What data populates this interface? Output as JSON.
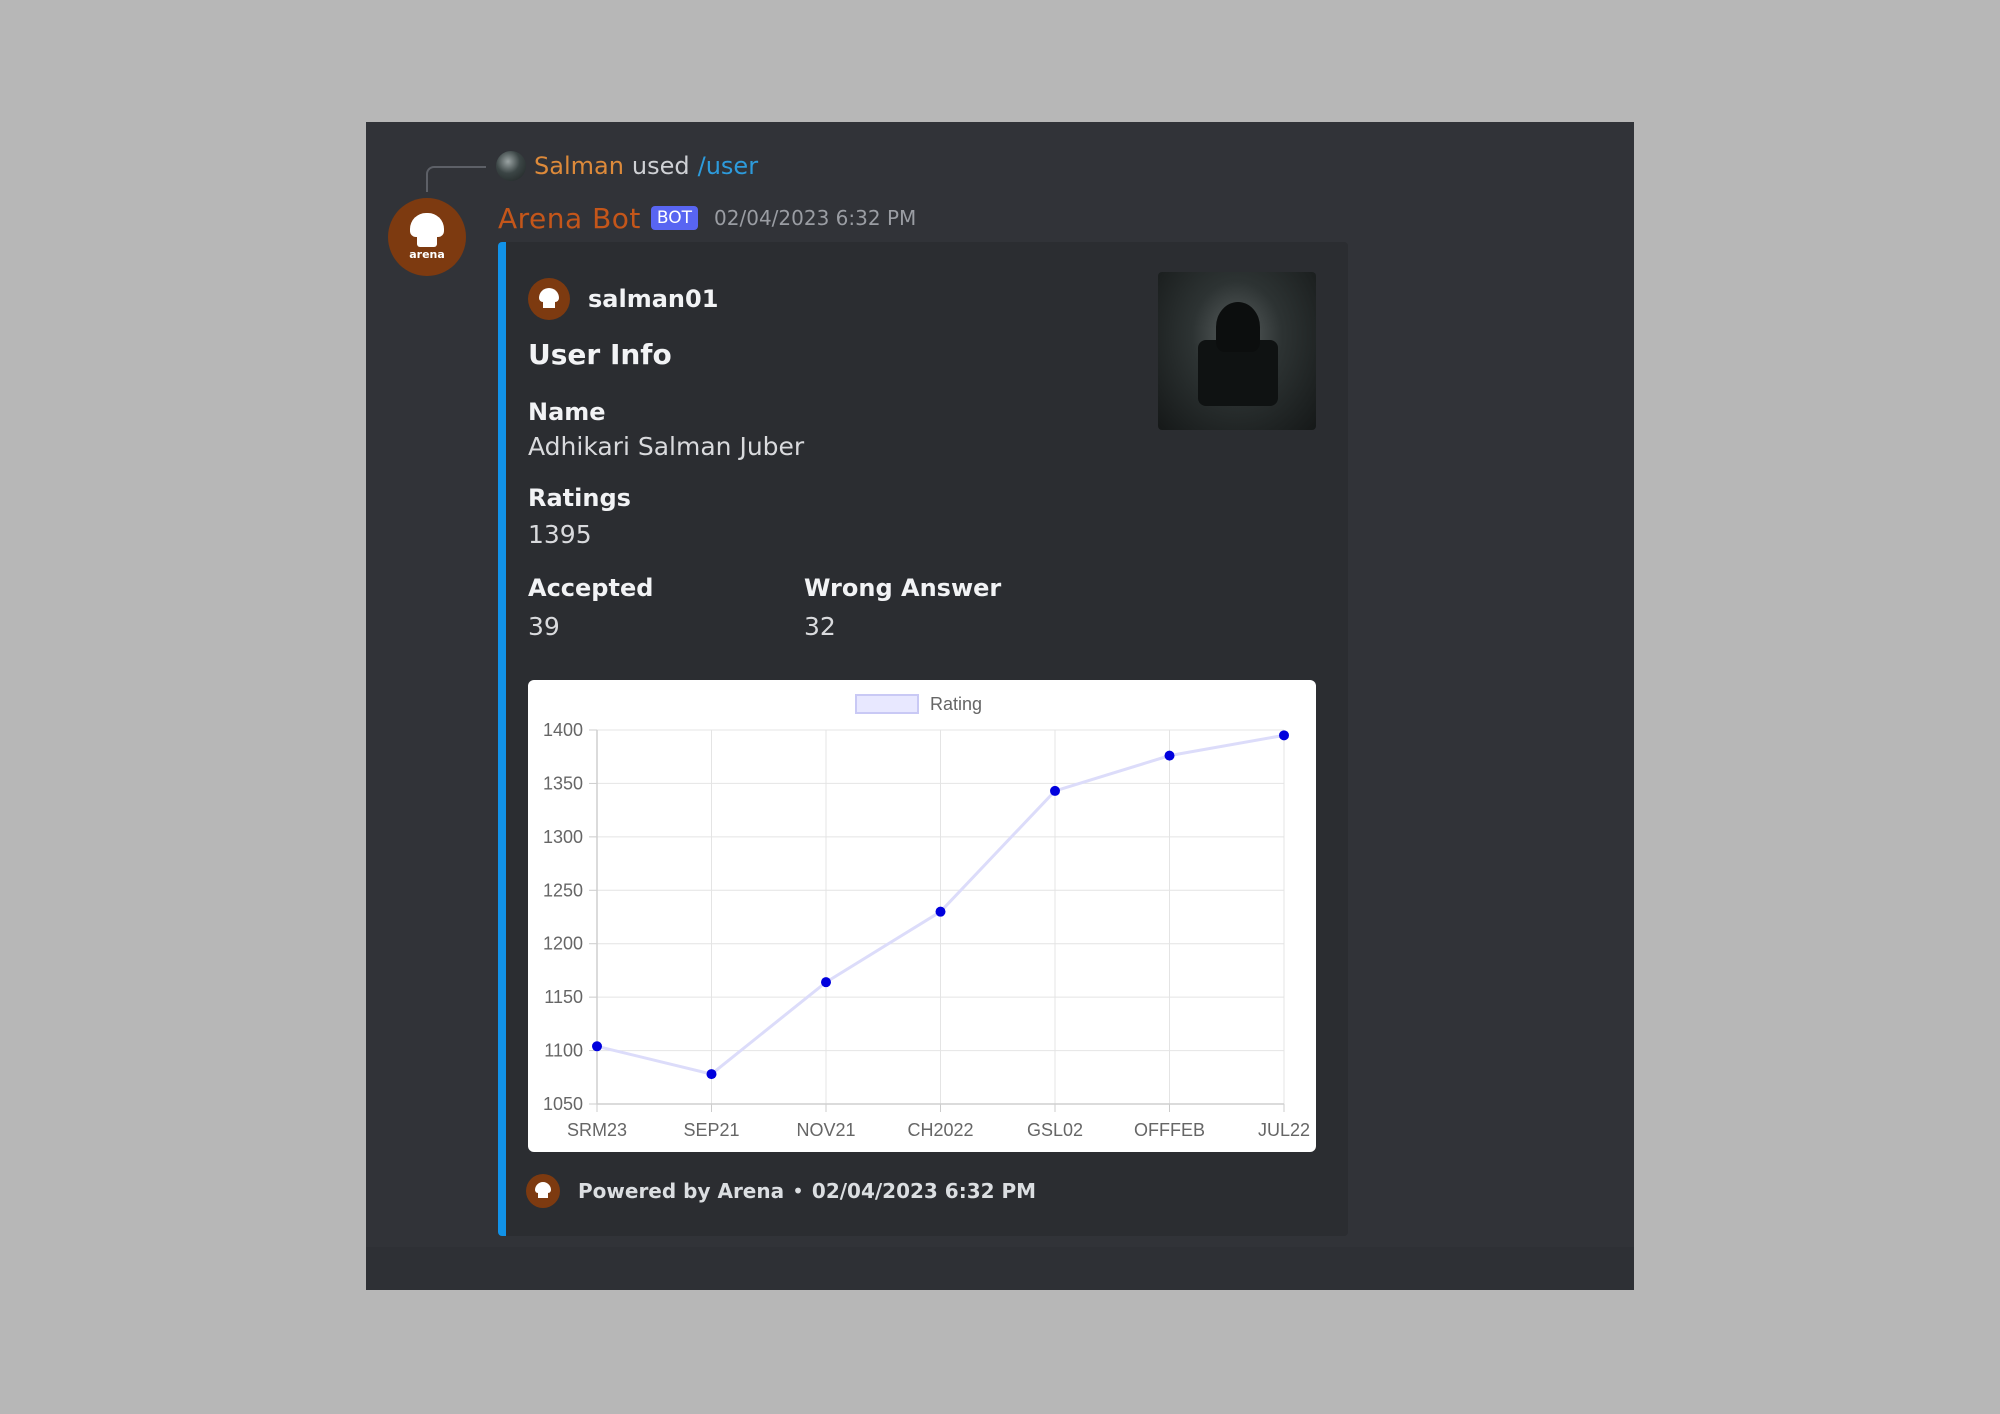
{
  "reply": {
    "user": "Salman",
    "used": "used",
    "command": "/user"
  },
  "message": {
    "bot_name": "Arena Bot",
    "badge": "BOT",
    "timestamp": "02/04/2023 6:32 PM",
    "avatar_text": "arena"
  },
  "embed": {
    "author": "salman01",
    "title": "User Info",
    "fields": [
      {
        "name": "Name",
        "value": "Adhikari Salman Juber"
      },
      {
        "name": "Ratings",
        "value": "1395"
      },
      {
        "name": "Accepted",
        "value": "39"
      },
      {
        "name": "Wrong Answer",
        "value": "32"
      }
    ],
    "footer": {
      "text": "Powered by Arena",
      "separator": "•",
      "timestamp": "02/04/2023 6:32 PM"
    },
    "accent_color": "#1192e8"
  },
  "chart_data": {
    "type": "line",
    "categories": [
      "SRM23",
      "SEP21",
      "NOV21",
      "CH2022",
      "GSL02",
      "OFFFEB",
      "JUL22"
    ],
    "series": [
      {
        "name": "Rating",
        "values": [
          1104,
          1078,
          1164,
          1230,
          1343,
          1376,
          1395
        ],
        "color": "#0000dd"
      }
    ],
    "ylim": [
      1050,
      1400
    ],
    "yticks": [
      1400,
      1350,
      1300,
      1250,
      1200,
      1150,
      1100,
      1050
    ],
    "legend_position": "top",
    "grid": true
  }
}
